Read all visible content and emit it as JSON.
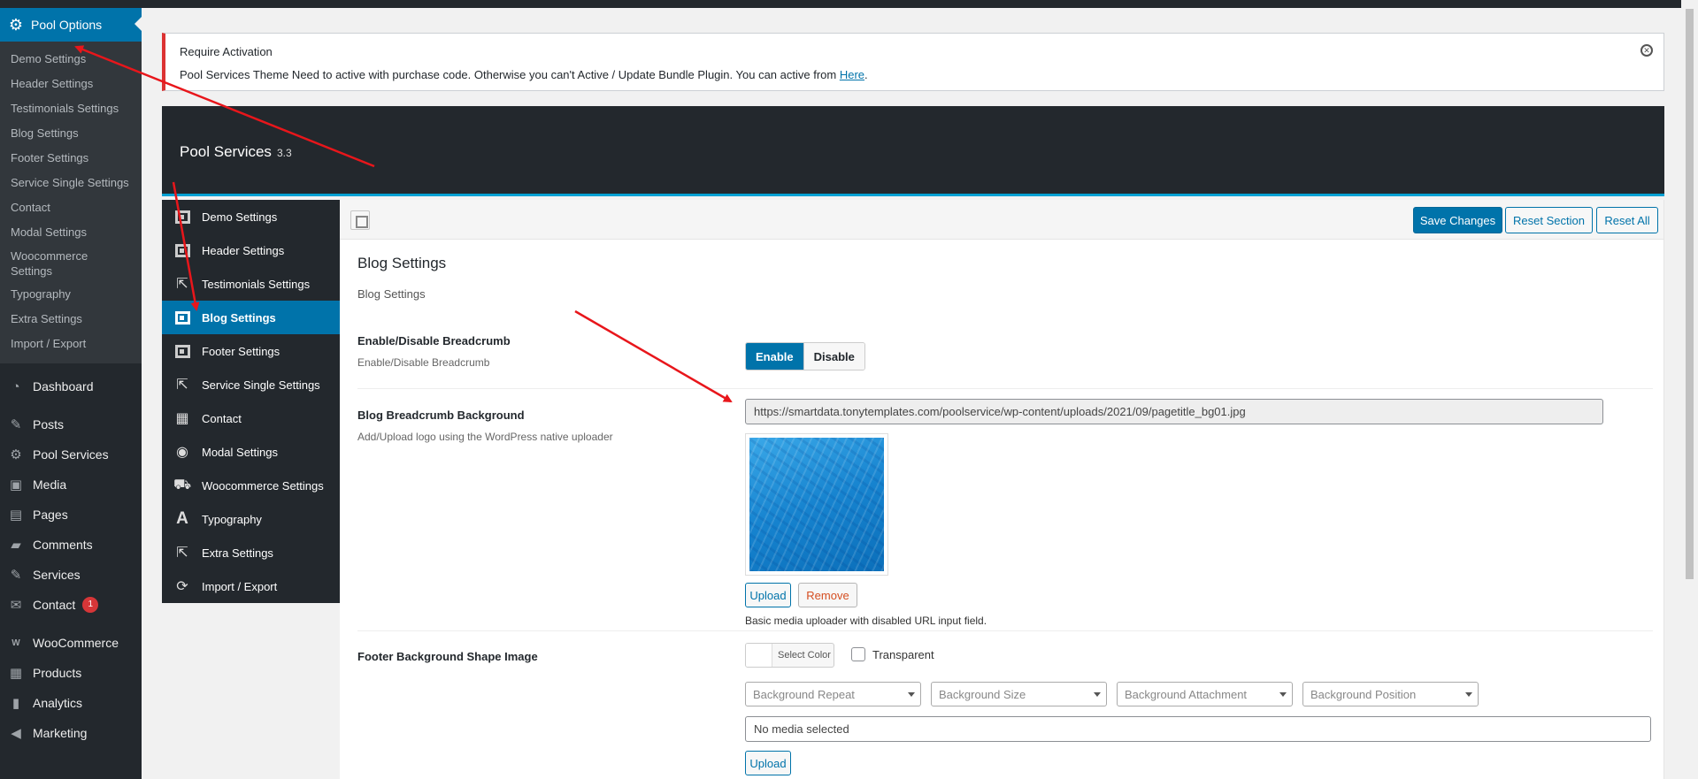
{
  "wp_menu": {
    "current_label": "Pool Options",
    "submenu": [
      "Demo Settings",
      "Header Settings",
      "Testimonials Settings",
      "Blog Settings",
      "Footer Settings",
      "Service Single Settings",
      "Contact",
      "Modal Settings",
      "Woocommerce Settings",
      "Typography",
      "Extra Settings",
      "Import / Export"
    ],
    "items": [
      {
        "label": "Dashboard",
        "icon": "dashboard-icon"
      },
      {
        "label": "Posts",
        "icon": "pin-icon"
      },
      {
        "label": "Pool Services",
        "icon": "gear-icon"
      },
      {
        "label": "Media",
        "icon": "media-icon"
      },
      {
        "label": "Pages",
        "icon": "pages-icon"
      },
      {
        "label": "Comments",
        "icon": "comment-icon"
      },
      {
        "label": "Services",
        "icon": "pin-icon"
      },
      {
        "label": "Contact",
        "icon": "mail-icon",
        "badge": "1"
      },
      {
        "label": "WooCommerce",
        "icon": "woo-icon"
      },
      {
        "label": "Products",
        "icon": "archive-icon"
      },
      {
        "label": "Analytics",
        "icon": "bar-chart-icon"
      },
      {
        "label": "Marketing",
        "icon": "megaphone-icon"
      }
    ]
  },
  "notice": {
    "title": "Require Activation",
    "message": "Pool Services Theme Need to active with purchase code. Otherwise you can't Active / Update Bundle Plugin. You can active from ",
    "link": "Here",
    "message_end": "."
  },
  "panel": {
    "name": "Pool Services",
    "version": "3.3",
    "sections": [
      {
        "label": "Demo Settings",
        "icon": "box-icon"
      },
      {
        "label": "Header Settings",
        "icon": "box-icon"
      },
      {
        "label": "Testimonials Settings",
        "icon": "share-icon"
      },
      {
        "label": "Blog Settings",
        "icon": "box-icon",
        "active": true
      },
      {
        "label": "Footer Settings",
        "icon": "box-icon"
      },
      {
        "label": "Service Single Settings",
        "icon": "share-icon"
      },
      {
        "label": "Contact",
        "icon": "grid-icon"
      },
      {
        "label": "Modal Settings",
        "icon": "circle-icon"
      },
      {
        "label": "Woocommerce Settings",
        "icon": "cart-icon"
      },
      {
        "label": "Typography",
        "icon": "font-icon"
      },
      {
        "label": "Extra Settings",
        "icon": "share-icon"
      },
      {
        "label": "Import / Export",
        "icon": "refresh-icon"
      }
    ],
    "toolbar": {
      "save": "Save Changes",
      "reset_section": "Reset Section",
      "reset_all": "Reset All"
    },
    "section": {
      "title": "Blog Settings",
      "desc": "Blog Settings"
    },
    "fields": {
      "breadcrumb": {
        "title": "Enable/Disable Breadcrumb",
        "sub": "Enable/Disable Breadcrumb",
        "on": "Enable",
        "off": "Disable"
      },
      "bg": {
        "title": "Blog Breadcrumb Background",
        "sub": "Add/Upload logo using the WordPress native uploader",
        "url": "https://smartdata.tonytemplates.com/poolservice/wp-content/uploads/2021/09/pagetitle_bg01.jpg",
        "upload": "Upload",
        "remove": "Remove",
        "hint": "Basic media uploader with disabled URL input field."
      },
      "footer_bg": {
        "title": "Footer Background Shape Image",
        "select_color": "Select Color",
        "transparent": "Transparent",
        "selects": [
          "Background Repeat",
          "Background Size",
          "Background Attachment",
          "Background Position"
        ],
        "media": "No media selected",
        "upload": "Upload"
      }
    }
  },
  "colors": {
    "wp_dark": "#23282d",
    "wp_blue": "#0073aa",
    "arrow_red": "#e8161b"
  }
}
